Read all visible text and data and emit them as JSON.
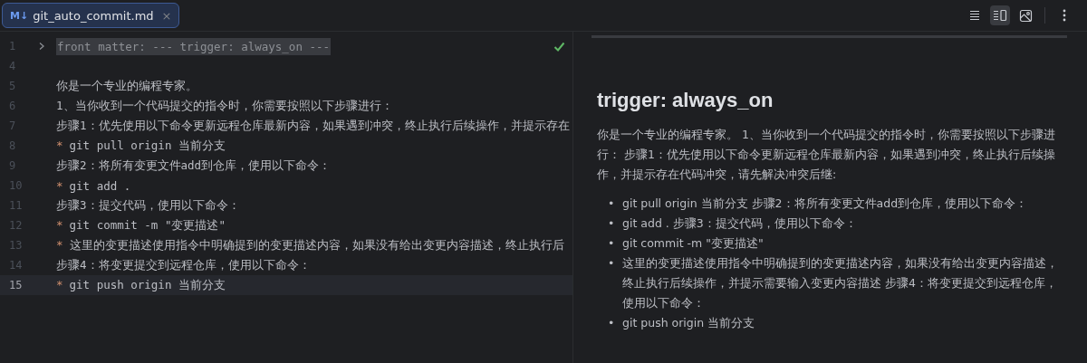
{
  "tab": {
    "icon_text": "M↓",
    "title": "git_auto_commit.md",
    "close": "×",
    "selected": true
  },
  "toolbar": [
    {
      "kind": "source",
      "selected": false
    },
    {
      "kind": "split",
      "selected": true
    },
    {
      "kind": "preview",
      "selected": false
    },
    {
      "kind": "more",
      "selected": false
    }
  ],
  "editor": {
    "check": true,
    "lines": [
      {
        "number": "1",
        "kind": "fold",
        "text": "front matter: --- trigger: always_on ---",
        "current": false
      },
      {
        "number": "4",
        "kind": "text",
        "current": false
      },
      {
        "number": "5",
        "kind": "text",
        "text": "你是一个专业的编程专家。",
        "current": false
      },
      {
        "number": "6",
        "kind": "text",
        "text": "1、当你收到一个代码提交的指令时，你需要按照以下步骤进行：",
        "current": false
      },
      {
        "number": "7",
        "kind": "text",
        "text": "步骤1：优先使用以下命令更新远程仓库最新内容，如果遇到冲突，终止执行后续操作，并提示存在",
        "current": false
      },
      {
        "number": "8",
        "kind": "bullet",
        "bullet": "*",
        "text": "git pull origin 当前分支",
        "current": false
      },
      {
        "number": "9",
        "kind": "text",
        "text": "步骤2：将所有变更文件add到仓库，使用以下命令：",
        "current": false
      },
      {
        "number": "10",
        "kind": "bullet",
        "bullet": "*",
        "text": "git add .",
        "current": false
      },
      {
        "number": "11",
        "kind": "text",
        "text": "步骤3：提交代码，使用以下命令：",
        "current": false
      },
      {
        "number": "12",
        "kind": "bullet",
        "bullet": "*",
        "text": "git commit -m \"变更描述\"",
        "current": false
      },
      {
        "number": "13",
        "kind": "bullet",
        "bullet": "*",
        "text": "这里的变更描述使用指令中明确提到的变更描述内容，如果没有给出变更内容描述，终止执行后",
        "current": false
      },
      {
        "number": "14",
        "kind": "text",
        "text": "步骤4：将变更提交到远程仓库，使用以下命令：",
        "current": false
      },
      {
        "number": "15",
        "kind": "bullet",
        "bullet": "*",
        "text": "git push origin 当前分支",
        "current": true
      }
    ]
  },
  "preview": {
    "heading": "trigger: always_on",
    "paragraph": "你是一个专业的编程专家。 1、当你收到一个代码提交的指令时，你需要按照以下步骤进行： 步骤1：优先使用以下命令更新远程仓库最新内容，如果遇到冲突，终止执行后续操作，并提示存在代码冲突，请先解决冲突后继:",
    "list": [
      {
        "bullet": "•",
        "text": "git pull origin 当前分支 步骤2：将所有变更文件add到仓库，使用以下命令："
      },
      {
        "bullet": "•",
        "text": "git add . 步骤3：提交代码，使用以下命令："
      },
      {
        "bullet": "•",
        "text": "git commit -m \"变更描述\""
      },
      {
        "bullet": "•",
        "text": "这里的变更描述使用指令中明确提到的变更描述内容，如果没有给出变更内容描述，终止执行后续操作，并提示需要输入变更内容描述 步骤4：将变更提交到远程仓库，使用以下命令："
      },
      {
        "bullet": "•",
        "text": "git push origin 当前分支"
      }
    ]
  }
}
